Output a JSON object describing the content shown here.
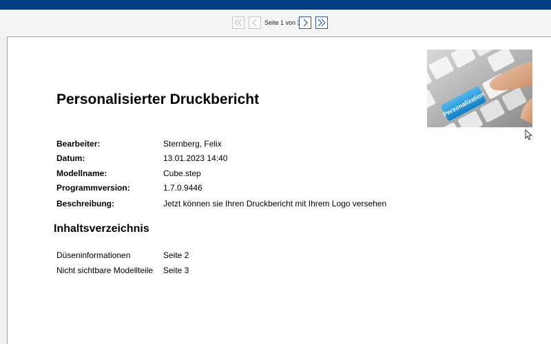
{
  "nav": {
    "page_info": "Seite 1 von 3",
    "first_icon": "first-page-icon",
    "prev_icon": "previous-page-icon",
    "next_icon": "next-page-icon",
    "last_icon": "last-page-icon"
  },
  "report": {
    "title": "Personalisierter Druckbericht",
    "logo_key_text": "Personalization",
    "fields": [
      {
        "label": "Bearbeiter:",
        "value": "Sternberg, Felix"
      },
      {
        "label": "Datum:",
        "value": "13.01.2023 14:40"
      },
      {
        "label": "Modellname:",
        "value": "Cube.step"
      },
      {
        "label": "Programmversion:",
        "value": "1.7.0.9446"
      },
      {
        "label": "Beschreibung:",
        "value": "Jetzt können sie Ihren Druckbericht mit Ihrem Logo versehen"
      }
    ],
    "toc_title": "Inhaltsverzeichnis",
    "toc": [
      {
        "label": "Düseninformationen",
        "page": "Seite 2"
      },
      {
        "label": "Nicht sichtbare Modellteile",
        "page": "Seite 3"
      }
    ]
  },
  "colors": {
    "topbar": "#003d85",
    "accent": "#2b5797",
    "key_blue": "#1e9be0"
  }
}
